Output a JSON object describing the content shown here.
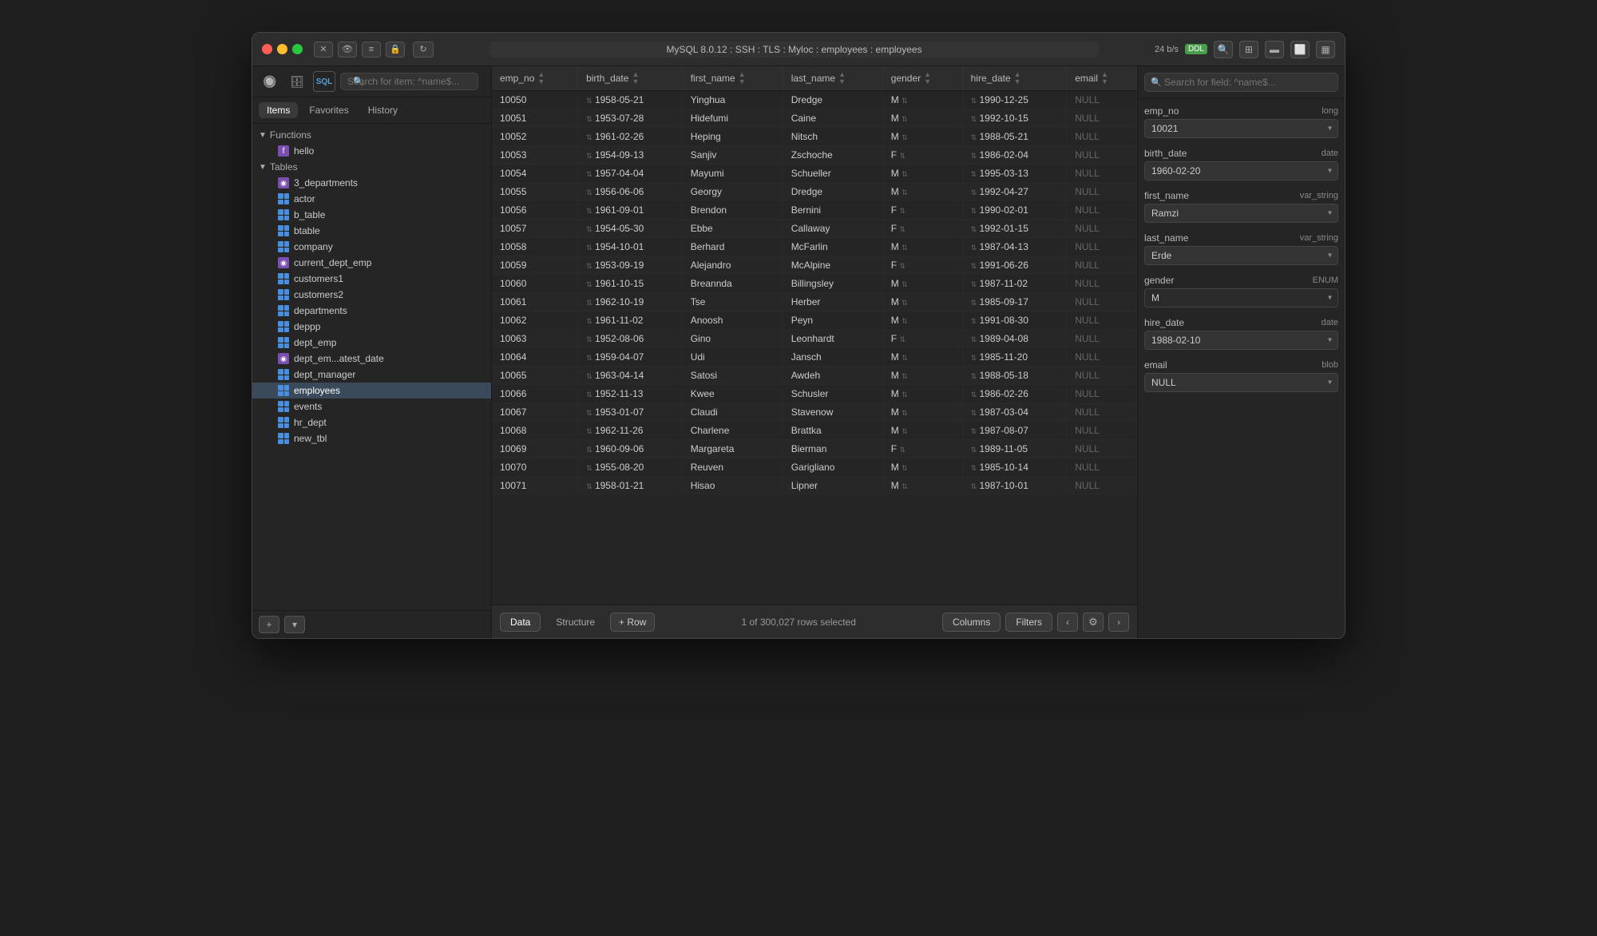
{
  "window": {
    "title": "MySQL 8.0.12 : SSH : TLS : Myloc : employees : employees",
    "speed": "24 b/s",
    "speed_badge": "DDL"
  },
  "titlebar": {
    "connection_label": "MySQL 8.0.12 : SSH : TLS : Myloc : employees : employees"
  },
  "sidebar": {
    "search_placeholder": "Search for item: ^name$...",
    "tabs": [
      "Items",
      "Favorites",
      "History"
    ],
    "active_tab": "Items",
    "functions_label": "Functions",
    "hello_label": "hello",
    "tables_label": "Tables",
    "tables": [
      "3_departments",
      "actor",
      "b_table",
      "btable",
      "company",
      "current_dept_emp",
      "customers1",
      "customers2",
      "departments",
      "deppp",
      "dept_emp",
      "dept_em...atest_date",
      "dept_manager",
      "employees",
      "events",
      "hr_dept",
      "new_tbl"
    ],
    "active_table": "employees"
  },
  "table": {
    "columns": [
      "emp_no",
      "birth_date",
      "first_name",
      "last_name",
      "gender",
      "hire_date",
      "email"
    ],
    "rows": [
      {
        "emp_no": "10050",
        "birth_date": "1958-05-21",
        "first_name": "Yinghua",
        "last_name": "Dredge",
        "gender": "M",
        "hire_date": "1990-12-25",
        "email": "NULL"
      },
      {
        "emp_no": "10051",
        "birth_date": "1953-07-28",
        "first_name": "Hidefumi",
        "last_name": "Caine",
        "gender": "M",
        "hire_date": "1992-10-15",
        "email": "NULL"
      },
      {
        "emp_no": "10052",
        "birth_date": "1961-02-26",
        "first_name": "Heping",
        "last_name": "Nitsch",
        "gender": "M",
        "hire_date": "1988-05-21",
        "email": "NULL"
      },
      {
        "emp_no": "10053",
        "birth_date": "1954-09-13",
        "first_name": "Sanjiv",
        "last_name": "Zschoche",
        "gender": "F",
        "hire_date": "1986-02-04",
        "email": "NULL"
      },
      {
        "emp_no": "10054",
        "birth_date": "1957-04-04",
        "first_name": "Mayumi",
        "last_name": "Schueller",
        "gender": "M",
        "hire_date": "1995-03-13",
        "email": "NULL"
      },
      {
        "emp_no": "10055",
        "birth_date": "1956-06-06",
        "first_name": "Georgy",
        "last_name": "Dredge",
        "gender": "M",
        "hire_date": "1992-04-27",
        "email": "NULL"
      },
      {
        "emp_no": "10056",
        "birth_date": "1961-09-01",
        "first_name": "Brendon",
        "last_name": "Bernini",
        "gender": "F",
        "hire_date": "1990-02-01",
        "email": "NULL"
      },
      {
        "emp_no": "10057",
        "birth_date": "1954-05-30",
        "first_name": "Ebbe",
        "last_name": "Callaway",
        "gender": "F",
        "hire_date": "1992-01-15",
        "email": "NULL"
      },
      {
        "emp_no": "10058",
        "birth_date": "1954-10-01",
        "first_name": "Berhard",
        "last_name": "McFarlin",
        "gender": "M",
        "hire_date": "1987-04-13",
        "email": "NULL"
      },
      {
        "emp_no": "10059",
        "birth_date": "1953-09-19",
        "first_name": "Alejandro",
        "last_name": "McAlpine",
        "gender": "F",
        "hire_date": "1991-06-26",
        "email": "NULL"
      },
      {
        "emp_no": "10060",
        "birth_date": "1961-10-15",
        "first_name": "Breannda",
        "last_name": "Billingsley",
        "gender": "M",
        "hire_date": "1987-11-02",
        "email": "NULL"
      },
      {
        "emp_no": "10061",
        "birth_date": "1962-10-19",
        "first_name": "Tse",
        "last_name": "Herber",
        "gender": "M",
        "hire_date": "1985-09-17",
        "email": "NULL"
      },
      {
        "emp_no": "10062",
        "birth_date": "1961-11-02",
        "first_name": "Anoosh",
        "last_name": "Peyn",
        "gender": "M",
        "hire_date": "1991-08-30",
        "email": "NULL"
      },
      {
        "emp_no": "10063",
        "birth_date": "1952-08-06",
        "first_name": "Gino",
        "last_name": "Leonhardt",
        "gender": "F",
        "hire_date": "1989-04-08",
        "email": "NULL"
      },
      {
        "emp_no": "10064",
        "birth_date": "1959-04-07",
        "first_name": "Udi",
        "last_name": "Jansch",
        "gender": "M",
        "hire_date": "1985-11-20",
        "email": "NULL"
      },
      {
        "emp_no": "10065",
        "birth_date": "1963-04-14",
        "first_name": "Satosi",
        "last_name": "Awdeh",
        "gender": "M",
        "hire_date": "1988-05-18",
        "email": "NULL"
      },
      {
        "emp_no": "10066",
        "birth_date": "1952-11-13",
        "first_name": "Kwee",
        "last_name": "Schusler",
        "gender": "M",
        "hire_date": "1986-02-26",
        "email": "NULL"
      },
      {
        "emp_no": "10067",
        "birth_date": "1953-01-07",
        "first_name": "Claudi",
        "last_name": "Stavenow",
        "gender": "M",
        "hire_date": "1987-03-04",
        "email": "NULL"
      },
      {
        "emp_no": "10068",
        "birth_date": "1962-11-26",
        "first_name": "Charlene",
        "last_name": "Brattka",
        "gender": "M",
        "hire_date": "1987-08-07",
        "email": "NULL"
      },
      {
        "emp_no": "10069",
        "birth_date": "1960-09-06",
        "first_name": "Margareta",
        "last_name": "Bierman",
        "gender": "F",
        "hire_date": "1989-11-05",
        "email": "NULL"
      },
      {
        "emp_no": "10070",
        "birth_date": "1955-08-20",
        "first_name": "Reuven",
        "last_name": "Garigliano",
        "gender": "M",
        "hire_date": "1985-10-14",
        "email": "NULL"
      },
      {
        "emp_no": "10071",
        "birth_date": "1958-01-21",
        "first_name": "Hisao",
        "last_name": "Lipner",
        "gender": "M",
        "hire_date": "1987-10-01",
        "email": "NULL"
      }
    ]
  },
  "bottom_bar": {
    "data_tab": "Data",
    "structure_tab": "Structure",
    "add_row_label": "+ Row",
    "row_count": "1 of 300,027 rows selected",
    "columns_btn": "Columns",
    "filters_btn": "Filters"
  },
  "right_panel": {
    "search_placeholder": "Search for field: ^name$...",
    "fields": [
      {
        "name": "emp_no",
        "type": "long",
        "value": "10021"
      },
      {
        "name": "birth_date",
        "type": "date",
        "value": "1960-02-20"
      },
      {
        "name": "first_name",
        "type": "var_string",
        "value": "Ramzi"
      },
      {
        "name": "last_name",
        "type": "var_string",
        "value": "Erde"
      },
      {
        "name": "gender",
        "type": "ENUM",
        "value": "M"
      },
      {
        "name": "hire_date",
        "type": "date",
        "value": "1988-02-10"
      },
      {
        "name": "email",
        "type": "blob",
        "value": "NULL"
      }
    ]
  }
}
